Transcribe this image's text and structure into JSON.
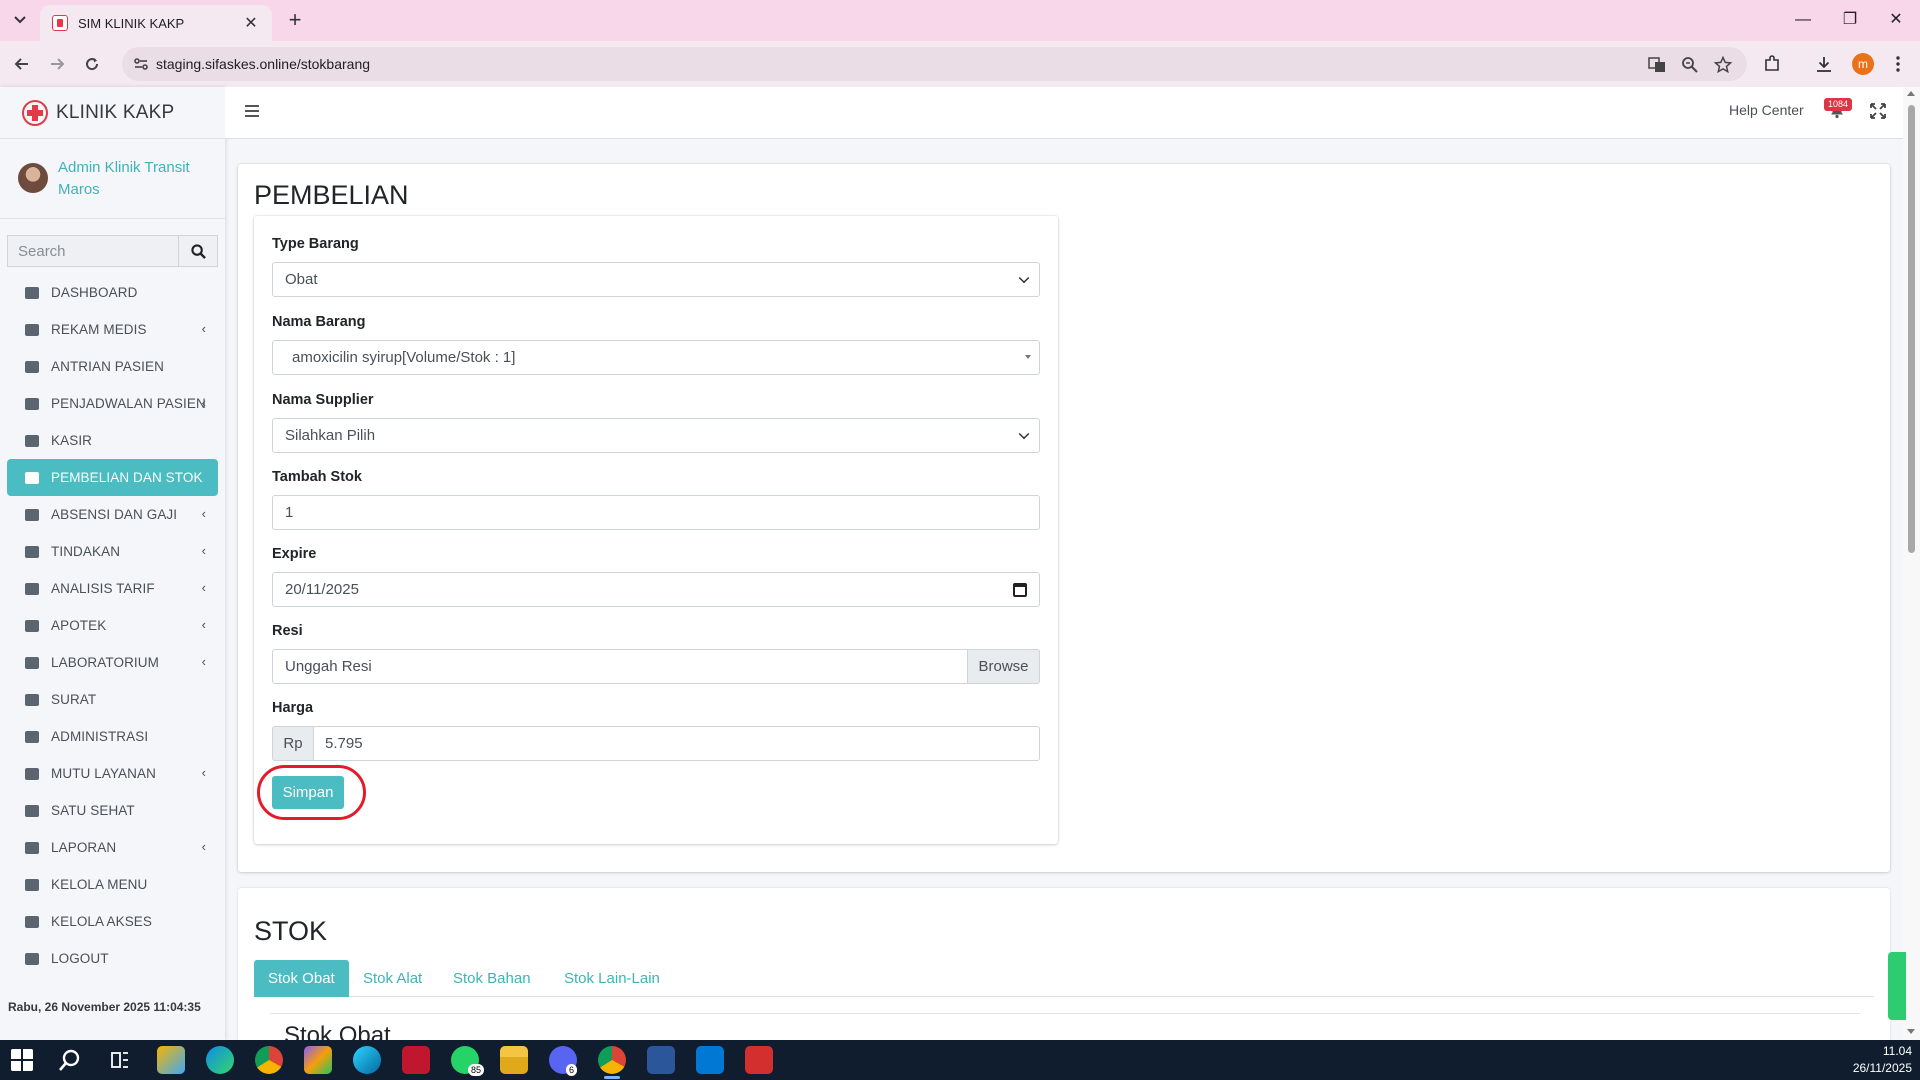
{
  "browser": {
    "tab_title": "SIM KLINIK KAKP",
    "url": "staging.sifaskes.online/stokbarang",
    "profile_initial": "m"
  },
  "brand": {
    "name": "KLINIK KAKP"
  },
  "user": {
    "name": "Admin Klinik Transit Maros"
  },
  "sidebar": {
    "search_placeholder": "Search",
    "items": [
      {
        "label": "DASHBOARD",
        "caret": false
      },
      {
        "label": "REKAM MEDIS",
        "caret": true
      },
      {
        "label": "ANTRIAN PASIEN",
        "caret": false
      },
      {
        "label": "PENJADWALAN PASIEN",
        "caret": true
      },
      {
        "label": "KASIR",
        "caret": false
      },
      {
        "label": "PEMBELIAN DAN STOK",
        "caret": false,
        "active": true
      },
      {
        "label": "ABSENSI DAN GAJI",
        "caret": true
      },
      {
        "label": "TINDAKAN",
        "caret": true
      },
      {
        "label": "ANALISIS TARIF",
        "caret": true
      },
      {
        "label": "APOTEK",
        "caret": true
      },
      {
        "label": "LABORATORIUM",
        "caret": true
      },
      {
        "label": "SURAT",
        "caret": false
      },
      {
        "label": "ADMINISTRASI",
        "caret": false
      },
      {
        "label": "MUTU LAYANAN",
        "caret": true
      },
      {
        "label": "SATU SEHAT",
        "caret": false
      },
      {
        "label": "LAPORAN",
        "caret": true
      },
      {
        "label": "KELOLA MENU",
        "caret": false
      },
      {
        "label": "KELOLA AKSES",
        "caret": false
      },
      {
        "label": "LOGOUT",
        "caret": false
      }
    ],
    "footer_datetime": "Rabu, 26 November 2025 11:04:35"
  },
  "topbar": {
    "help_label": "Help Center",
    "notif_count": "1084"
  },
  "pembelian": {
    "title": "PEMBELIAN",
    "type_barang_label": "Type Barang",
    "type_barang_value": "Obat",
    "nama_barang_label": "Nama Barang",
    "nama_barang_value": "amoxicilin syirup[Volume/Stok : 1]",
    "nama_supplier_label": "Nama Supplier",
    "nama_supplier_value": "Silahkan Pilih",
    "tambah_stok_label": "Tambah Stok",
    "tambah_stok_value": "1",
    "expire_label": "Expire",
    "expire_value": "20/11/2025",
    "resi_label": "Resi",
    "resi_placeholder": "Unggah Resi",
    "browse_label": "Browse",
    "harga_label": "Harga",
    "harga_prefix": "Rp",
    "harga_value": "5.795",
    "submit_label": "Simpan"
  },
  "stok": {
    "title": "STOK",
    "tabs": [
      "Stok Obat",
      "Stok Alat",
      "Stok Bahan",
      "Stok Lain-Lain"
    ],
    "sub_title": "Stok Obat"
  },
  "taskbar": {
    "whatsapp_badge": "85",
    "discord_badge": "6",
    "time": "11.04",
    "date": "26/11/2025"
  }
}
